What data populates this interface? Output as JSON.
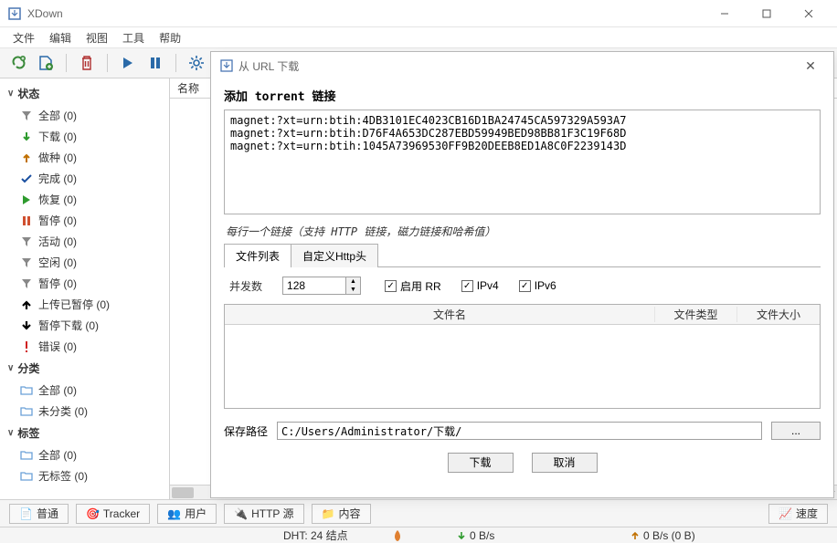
{
  "window": {
    "title": "XDown",
    "menu": [
      "文件",
      "编辑",
      "视图",
      "工具",
      "帮助"
    ]
  },
  "sidebar": {
    "groups": [
      {
        "title": "状态",
        "items": [
          {
            "icon": "funnel",
            "color": "#888",
            "label": "全部 (0)"
          },
          {
            "icon": "arrow-down",
            "color": "#2e9b2e",
            "label": "下载 (0)"
          },
          {
            "icon": "arrow-up",
            "color": "#c07000",
            "label": "做种 (0)"
          },
          {
            "icon": "check",
            "color": "#1a4fa0",
            "label": "完成 (0)"
          },
          {
            "icon": "play",
            "color": "#2e9b2e",
            "label": "恢复 (0)"
          },
          {
            "icon": "pause",
            "color": "#d05030",
            "label": "暂停 (0)"
          },
          {
            "icon": "funnel",
            "color": "#888",
            "label": "活动 (0)"
          },
          {
            "icon": "funnel",
            "color": "#888",
            "label": "空闲 (0)"
          },
          {
            "icon": "funnel",
            "color": "#888",
            "label": "暂停 (0)"
          },
          {
            "icon": "arrow-up-bold",
            "color": "#000",
            "label": "上传已暂停 (0)"
          },
          {
            "icon": "arrow-down-bold",
            "color": "#000",
            "label": "暂停下载 (0)"
          },
          {
            "icon": "exclaim",
            "color": "#d02020",
            "label": "错误 (0)"
          }
        ]
      },
      {
        "title": "分类",
        "items": [
          {
            "icon": "folder",
            "color": "#6aa0d8",
            "label": "全部 (0)"
          },
          {
            "icon": "folder",
            "color": "#6aa0d8",
            "label": "未分类 (0)"
          }
        ]
      },
      {
        "title": "标签",
        "items": [
          {
            "icon": "folder",
            "color": "#6aa0d8",
            "label": "全部 (0)"
          },
          {
            "icon": "folder",
            "color": "#6aa0d8",
            "label": "无标签 (0)"
          }
        ]
      }
    ]
  },
  "list_header": "名称",
  "bottom_tabs": {
    "general": "普通",
    "tracker": "Tracker",
    "users": "用户",
    "http": "HTTP 源",
    "content": "内容",
    "speed": "速度"
  },
  "statusbar": {
    "dht": "DHT: 24 结点",
    "down": "0 B/s",
    "up": "0 B/s (0 B)"
  },
  "dialog": {
    "title": "从 URL 下载",
    "heading": "添加 torrent 链接",
    "urls": "magnet:?xt=urn:btih:4DB3101EC4023CB16D1BA24745CA597329A593A7\nmagnet:?xt=urn:btih:D76F4A653DC287EBD59949BED98BB81F3C19F68D\nmagnet:?xt=urn:btih:1045A73969530FF9B20DEEB8ED1A8C0F2239143D",
    "hint": "每行一个链接（支持 HTTP 链接，磁力链接和哈希值）",
    "tab_filelist": "文件列表",
    "tab_httpheader": "自定义Http头",
    "concurrency_label": "并发数",
    "concurrency_value": "128",
    "chk_rr": "启用 RR",
    "chk_ipv4": "IPv4",
    "chk_ipv6": "IPv6",
    "col_filename": "文件名",
    "col_filetype": "文件类型",
    "col_filesize": "文件大小",
    "path_label": "保存路径",
    "path_value": "C:/Users/Administrator/下载/",
    "browse": "...",
    "btn_download": "下载",
    "btn_cancel": "取消"
  }
}
